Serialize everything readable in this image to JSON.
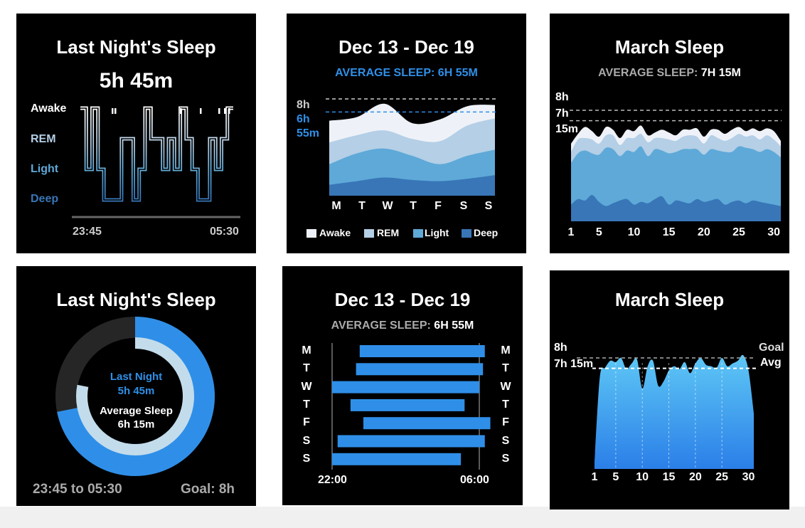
{
  "colors": {
    "awake": "#eef2f8",
    "rem": "#b4cfe6",
    "light": "#5ea9d8",
    "deep": "#3876b7",
    "accent": "#2f8fe8",
    "gray": "#aaaaaa"
  },
  "p1": {
    "title": "Last Night's Sleep",
    "duration": "5h 45m",
    "stages": [
      "Awake",
      "REM",
      "Light",
      "Deep"
    ],
    "start": "23:45",
    "end": "05:30"
  },
  "p2": {
    "title": "Dec 13 - Dec 19",
    "avg": "AVERAGE SLEEP: 6H 55M",
    "y8": "8h",
    "yavg": [
      "6h",
      "55m"
    ],
    "legend": [
      "Awake",
      "REM",
      "Light",
      "Deep"
    ]
  },
  "p3": {
    "title": "March Sleep",
    "avg_label": "AVERAGE SLEEP:",
    "avg_value": "7H 15M",
    "y8": "8h",
    "yavg": [
      "7h",
      "15m"
    ]
  },
  "p4": {
    "title": "Last Night's Sleep",
    "last_label": "Last Night",
    "last_value": "5h 45m",
    "avg_label": "Average Sleep",
    "avg_value": "6h 15m",
    "range": "23:45 to 05:30",
    "goal": "Goal: 8h"
  },
  "p5": {
    "title": "Dec 13 - Dec 19",
    "avg_label": "AVERAGE SLEEP:",
    "avg_value": "6H 55M",
    "start": "22:00",
    "end": "06:00"
  },
  "p6": {
    "title": "March Sleep",
    "y8": "8h",
    "yavg": "7h 15m",
    "goal": "Goal",
    "avg": "Avg"
  },
  "chart_data": [
    {
      "type": "line",
      "title": "Last Night's Sleep",
      "subtitle": "5h 45m",
      "categories": [
        "Awake",
        "REM",
        "Light",
        "Deep"
      ],
      "x_range": [
        "23:45",
        "05:30"
      ],
      "series": [
        {
          "values": [
            0,
            2,
            0,
            2,
            3,
            3,
            3,
            1,
            1,
            3,
            2,
            0,
            1,
            1,
            2,
            1,
            2,
            0,
            1,
            2,
            3,
            3,
            1,
            2,
            1,
            0
          ]
        }
      ]
    },
    {
      "type": "area",
      "title": "Dec 13 - Dec 19",
      "subtitle": "AVERAGE SLEEP: 6H 55M",
      "categories": [
        "M",
        "T",
        "W",
        "T",
        "F",
        "S",
        "S"
      ],
      "ylim": [
        0,
        9
      ],
      "reference_lines": [
        8,
        6.92
      ],
      "series": [
        {
          "name": "Deep",
          "values": [
            0.9,
            1.2,
            1.5,
            1.3,
            1.2,
            1.4,
            1.7
          ]
        },
        {
          "name": "Light",
          "values": [
            1.7,
            2.3,
            2.4,
            2.0,
            1.4,
            1.9,
            2.1
          ]
        },
        {
          "name": "REM",
          "values": [
            1.8,
            1.5,
            1.5,
            1.4,
            1.9,
            2.5,
            2.6
          ]
        },
        {
          "name": "Awake",
          "values": [
            1.8,
            1.5,
            2.2,
            1.3,
            1.8,
            1.6,
            1.1
          ]
        }
      ]
    },
    {
      "type": "area",
      "title": "March Sleep",
      "subtitle": "AVERAGE SLEEP: 7H 15M",
      "x": [
        1,
        2,
        3,
        4,
        5,
        6,
        7,
        8,
        9,
        10,
        11,
        12,
        13,
        14,
        15,
        16,
        17,
        18,
        19,
        20,
        21,
        22,
        23,
        24,
        25,
        26,
        27,
        28,
        29,
        30,
        31
      ],
      "x_ticks": [
        1,
        5,
        10,
        15,
        20,
        25,
        30
      ],
      "ylim": [
        0,
        9
      ],
      "reference_lines": [
        8,
        7.25
      ],
      "series": [
        {
          "name": "Deep",
          "values": [
            1.2,
            1.6,
            1.5,
            1.9,
            1.4,
            1.1,
            1.3,
            1.5,
            1.6,
            1.2,
            1.4,
            1.3,
            1.6,
            1.8,
            1.2,
            1.5,
            1.4,
            1.3,
            1.6,
            1.4,
            1.5,
            1.6,
            1.2,
            1.4,
            1.5,
            1.3,
            1.5,
            1.4,
            1.3,
            1.2,
            1.1
          ]
        },
        {
          "name": "Light",
          "values": [
            3.0,
            3.3,
            3.6,
            3.0,
            3.4,
            4.2,
            3.9,
            3.2,
            3.5,
            3.8,
            4.0,
            3.4,
            3.6,
            3.3,
            3.7,
            3.5,
            3.8,
            3.9,
            3.6,
            3.4,
            3.7,
            3.5,
            3.8,
            3.6,
            3.9,
            4.0,
            3.7,
            3.6,
            3.9,
            3.8,
            3.5
          ]
        },
        {
          "name": "REM",
          "values": [
            0.8,
            1.0,
            0.9,
            1.0,
            0.8,
            0.9,
            1.0,
            0.8,
            0.9,
            1.0,
            0.9,
            1.0,
            0.8,
            0.9,
            1.0,
            0.8,
            0.9,
            1.0,
            0.9,
            0.8,
            1.0,
            0.9,
            0.8,
            1.0,
            0.9,
            0.8,
            1.0,
            0.9,
            1.0,
            0.9,
            0.8
          ]
        },
        {
          "name": "Awake",
          "values": [
            0.6,
            0.4,
            0.8,
            0.6,
            0.5,
            0.6,
            0.4,
            0.5,
            0.6,
            0.5,
            0.6,
            0.5,
            0.4,
            0.6,
            0.5,
            0.4,
            0.5,
            0.4,
            0.6,
            0.5,
            0.4,
            0.6,
            0.5,
            0.6,
            0.5,
            0.4,
            0.5,
            0.6,
            0.5,
            0.6,
            0.4
          ]
        }
      ]
    },
    {
      "type": "pie",
      "title": "Last Night's Sleep",
      "series": [
        {
          "name": "Last Night",
          "values": [
            5.75
          ],
          "max": 8
        },
        {
          "name": "Average Sleep",
          "values": [
            6.25
          ],
          "max": 8
        }
      ],
      "goal": 8
    },
    {
      "type": "bar",
      "title": "Dec 13 - Dec 19",
      "subtitle": "AVERAGE SLEEP: 6H 55M",
      "categories": [
        "M",
        "T",
        "W",
        "T",
        "F",
        "S",
        "S"
      ],
      "x_range": [
        "22:00",
        "06:00"
      ],
      "bed_hour": [
        23.5,
        23.3,
        22.0,
        23.0,
        23.7,
        22.3,
        22.0
      ],
      "wake_hour": [
        6.3,
        6.2,
        6.0,
        5.2,
        6.6,
        6.3,
        5.0
      ]
    },
    {
      "type": "area",
      "title": "March Sleep",
      "x": [
        1,
        2,
        3,
        4,
        5,
        6,
        7,
        8,
        9,
        10,
        11,
        12,
        13,
        14,
        15,
        16,
        17,
        18,
        19,
        20,
        21,
        22,
        23,
        24,
        25,
        26,
        27,
        28,
        29,
        30,
        31
      ],
      "x_ticks": [
        1,
        5,
        10,
        15,
        20,
        25,
        30
      ],
      "ylim": [
        0,
        9
      ],
      "reference_lines": [
        {
          "name": "Goal",
          "value": 8
        },
        {
          "name": "Avg",
          "value": 7.25
        }
      ],
      "series": [
        {
          "values": [
            0.5,
            6.6,
            7.3,
            7.8,
            7.7,
            8.0,
            7.2,
            7.6,
            7.9,
            5.8,
            7.4,
            7.8,
            6.0,
            6.3,
            7.1,
            7.4,
            7.2,
            7.7,
            6.9,
            7.6,
            8.0,
            7.5,
            7.4,
            7.3,
            8.0,
            7.4,
            7.6,
            7.8,
            8.2,
            7.1,
            4.0
          ]
        }
      ]
    }
  ]
}
